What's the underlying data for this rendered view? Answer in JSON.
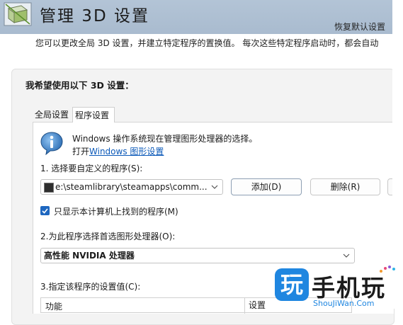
{
  "header": {
    "title": "管理 3D 设置",
    "restore_defaults": "恢复默认设置",
    "colors": {
      "band": "#b3c4d6"
    }
  },
  "intro": "您可以更改全局 3D 设置，并建立特定程序的置换值。 每次这些特定程序启动时，都会自动",
  "panel": {
    "heading": "我希望使用以下 3D 设置：",
    "tabs": [
      {
        "label": "全局设置",
        "selected": false
      },
      {
        "label": "程序设置",
        "selected": true
      }
    ]
  },
  "info": {
    "line1": "Windows 操作系统现在管理图形处理器的选择。",
    "line2_prefix": "打开",
    "line2_link": "Windows 图形设置",
    "icon": "info-icon"
  },
  "program": {
    "label": "1. 选择要自定义的程序(S):",
    "selected": "e:\\steamlibrary\\steamapps\\comm...",
    "add_button": "添加(D)",
    "delete_button": "删除(R)",
    "show_only_found_label": "只显示本计算机上找到的程序(M)",
    "show_only_found_checked": true
  },
  "gpu": {
    "label": "2.为此程序选择首选图形处理器(O):",
    "selected": "高性能 NVIDIA 处理器"
  },
  "settings": {
    "label": "3.指定该程序的设置值(C):",
    "columns": [
      "功能",
      "设置"
    ]
  },
  "watermark": {
    "badge": "玩",
    "text": "手机玩",
    "url": "ShouJiWan.Com",
    "badge_color": "#1f86e0"
  }
}
